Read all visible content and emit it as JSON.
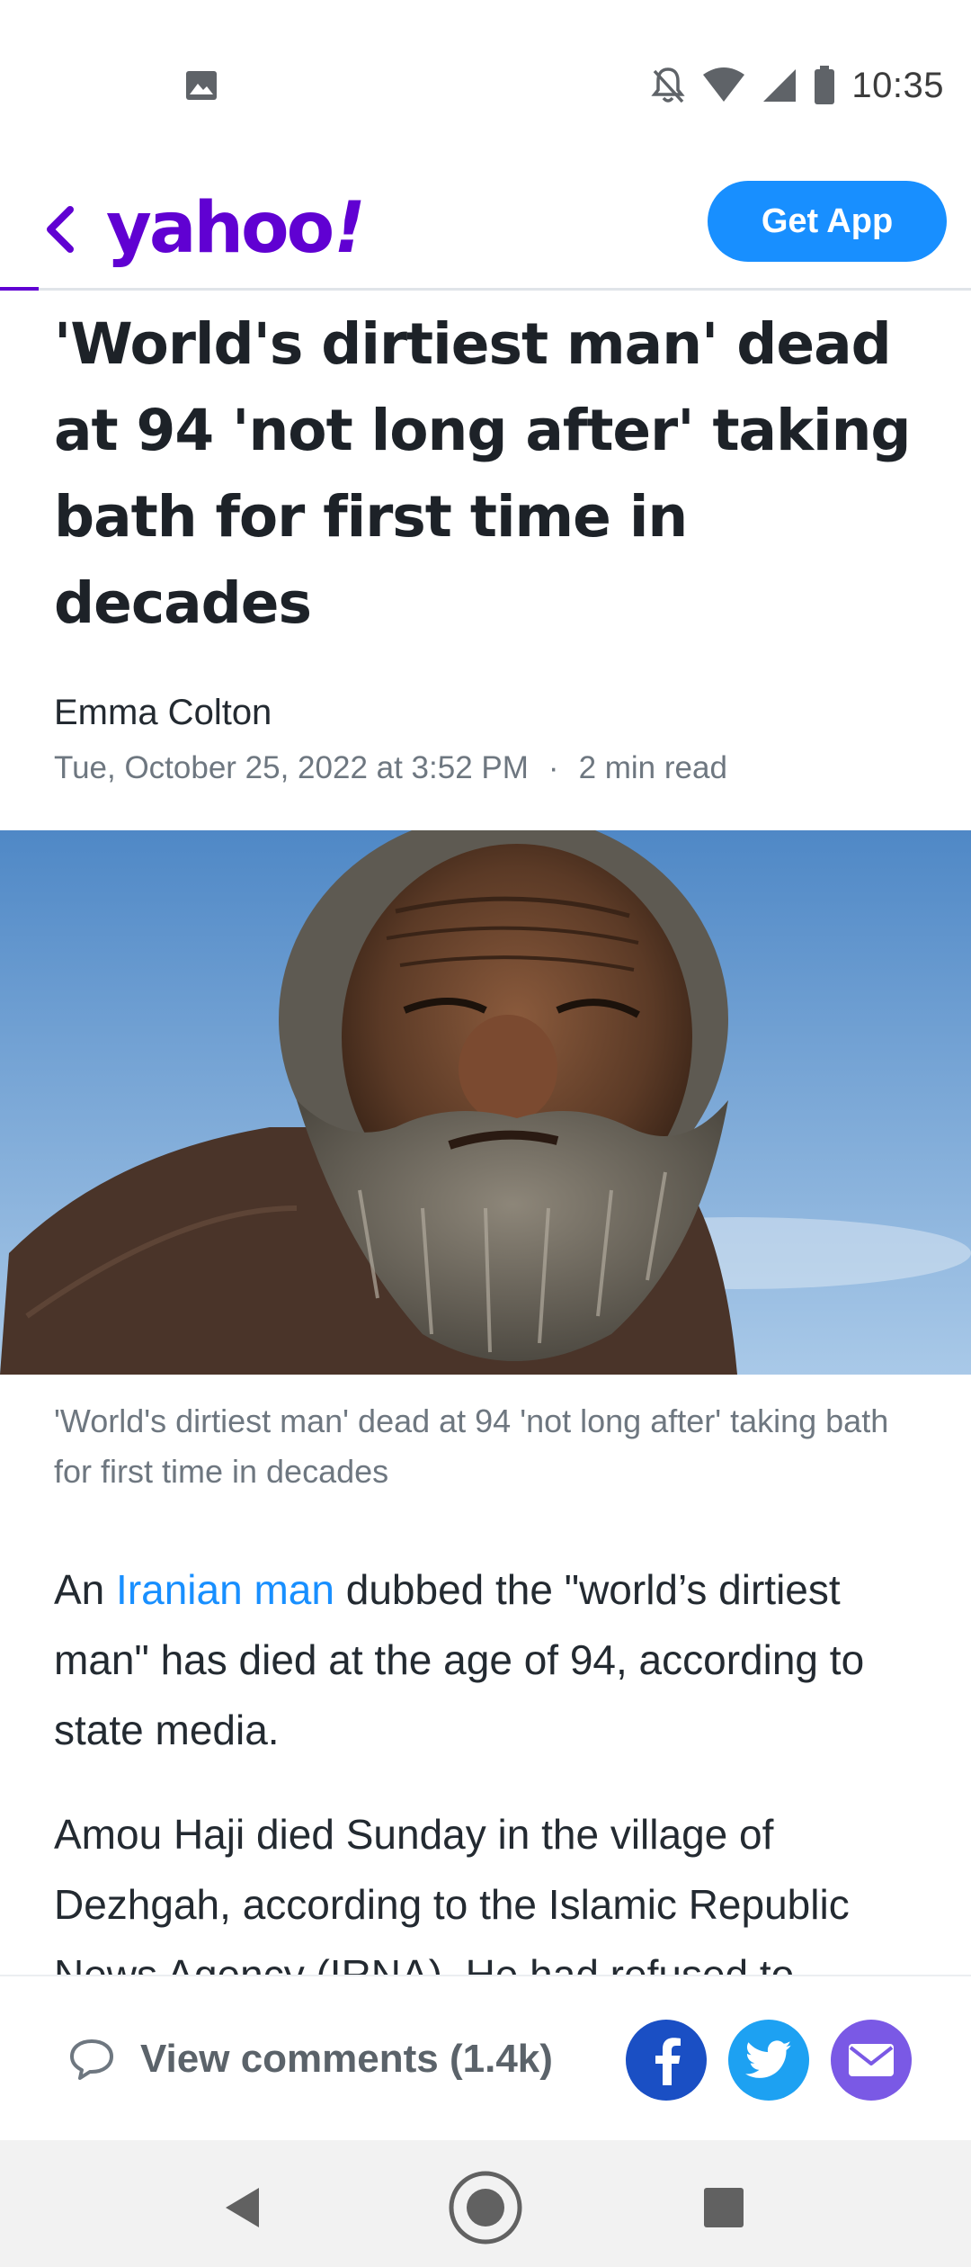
{
  "status_bar": {
    "time": "10:35",
    "left_icon": "image-notification-icon",
    "right_icons": [
      "notifications-off-icon",
      "wifi-icon",
      "cellular-signal-icon",
      "battery-icon"
    ]
  },
  "header": {
    "back_icon": "chevron-left-icon",
    "logo_text": "yahoo",
    "logo_bang": "!",
    "get_app_label": "Get App",
    "read_progress_percent": 4
  },
  "article": {
    "headline": "'World's dirtiest man' dead at 94 'not long after' taking bath for first time in decades",
    "author": "Emma Colton",
    "date": "Tue, October 25, 2022 at 3:52 PM",
    "separator": "·",
    "read_time": "2 min read",
    "image_caption": "'World's dirtiest man' dead at 94 'not long after' taking bath for first time in decades",
    "paragraph1": {
      "before_link": "An ",
      "link_text": "Iranian man",
      "after_link": " dubbed the \"world’s dirtiest man\" has died at the age of 94, according to state media."
    },
    "paragraph2": "Amou Haji died Sunday in the village of Dezhgah, according to the Islamic Republic News Agency (IRNA). He had refused to"
  },
  "toolbar": {
    "comments_label": "View comments (1.4k)",
    "comments_icon": "comment-bubble-icon",
    "share_icons": [
      "facebook-icon",
      "twitter-icon",
      "mail-icon"
    ]
  },
  "colors": {
    "yahoo_purple": "#6001d2",
    "get_app_blue": "#188fff",
    "link_blue": "#188fff",
    "facebook": "#1a4fc4",
    "twitter": "#1da1f2",
    "mail": "#7a59e5"
  },
  "nav_bar": {
    "icons": [
      "back-triangle-icon",
      "home-circle-icon",
      "recents-square-icon"
    ]
  }
}
